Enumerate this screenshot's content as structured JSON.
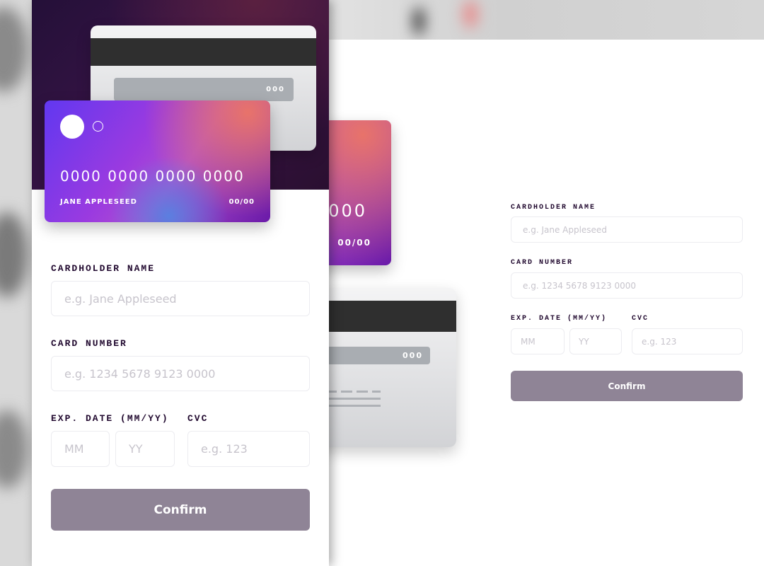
{
  "card": {
    "number": "0000 0000 0000 0000",
    "number_tail": "000",
    "name": "JANE APPLESEED",
    "expiry": "00/00",
    "cvc": "000"
  },
  "form": {
    "cardholder_label": "CARDHOLDER NAME",
    "cardholder_placeholder": "e.g. Jane Appleseed",
    "number_label": "CARD NUMBER",
    "number_placeholder": "e.g. 1234 5678 9123 0000",
    "exp_label": "EXP. DATE (MM/YY)",
    "mm_placeholder": "MM",
    "yy_placeholder": "YY",
    "cvc_label": "CVC",
    "cvc_placeholder": "e.g. 123",
    "confirm_label": "Confirm"
  },
  "colors": {
    "button": "#8f8496",
    "label": "#21092f",
    "header": "#2a0f3a"
  }
}
